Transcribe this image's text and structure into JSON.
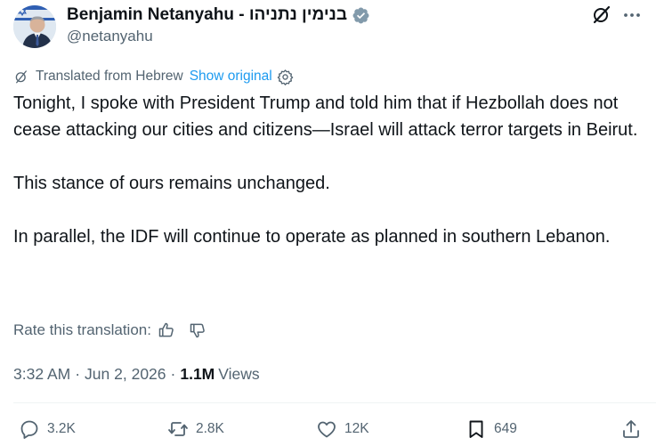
{
  "author": {
    "display_name": "Benjamin Netanyahu - בנימין נתניהו",
    "handle": "@netanyahu"
  },
  "translation": {
    "label": "Translated from Hebrew",
    "show_original": "Show original"
  },
  "post": {
    "paragraphs": [
      "Tonight, I spoke with President Trump and told him that if Hezbollah does not cease attacking our cities and citizens—Israel will attack terror targets in Beirut.",
      "This stance of ours remains unchanged.",
      "In parallel, the IDF will continue to operate as planned in southern Lebanon."
    ]
  },
  "rate": {
    "label": "Rate this translation:"
  },
  "meta": {
    "time": "3:32 AM",
    "date": "Jun 2, 2026",
    "views_count": "1.1M",
    "views_label": "Views",
    "separator": "·"
  },
  "actions": {
    "replies": "3.2K",
    "reposts": "2.8K",
    "likes": "12K",
    "bookmarks": "649"
  },
  "icons": {
    "grok": "grok-icon",
    "more": "more-icon",
    "globe": "translate-globe-icon",
    "settings": "settings-icon",
    "thumbs_up": "thumbs-up-icon",
    "thumbs_down": "thumbs-down-icon",
    "reply": "reply-icon",
    "repost": "repost-icon",
    "like": "like-icon",
    "bookmark": "bookmark-icon",
    "share": "share-icon"
  },
  "colors": {
    "text": "#0f1419",
    "secondary": "#536471",
    "link": "#1d9bf0",
    "verified": "#829aab"
  }
}
